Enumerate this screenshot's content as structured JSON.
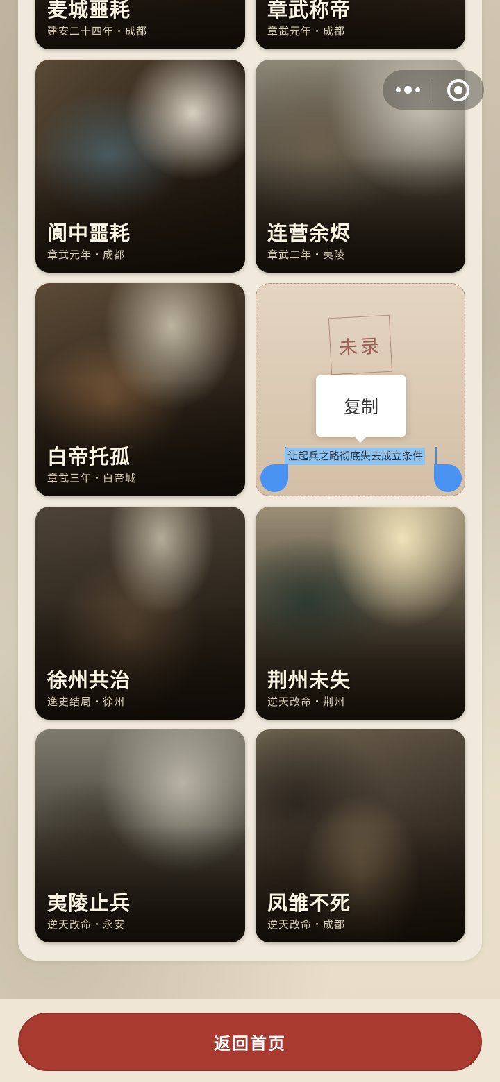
{
  "cards": [
    {
      "title": "麦城噩耗",
      "subtitle": "建安二十四年・成都"
    },
    {
      "title": "章武称帝",
      "subtitle": "章武元年・成都"
    },
    {
      "title": "阆中噩耗",
      "subtitle": "章武元年・成都"
    },
    {
      "title": "连营余烬",
      "subtitle": "章武二年・夷陵"
    },
    {
      "title": "白帝托孤",
      "subtitle": "章武三年・白帝城"
    },
    {
      "title": "徐州共治",
      "subtitle": "逸史结局・徐州"
    },
    {
      "title": "荆州未失",
      "subtitle": "逆天改命・荆州"
    },
    {
      "title": "夷陵止兵",
      "subtitle": "逆天改命・永安"
    },
    {
      "title": "凤雏不死",
      "subtitle": "逆天改命・成都"
    }
  ],
  "locked_card": {
    "seal": "未录",
    "selected_text": "让起兵之路彻底失去成立条件",
    "copy_menu": "复制"
  },
  "home_button": "返回首页"
}
